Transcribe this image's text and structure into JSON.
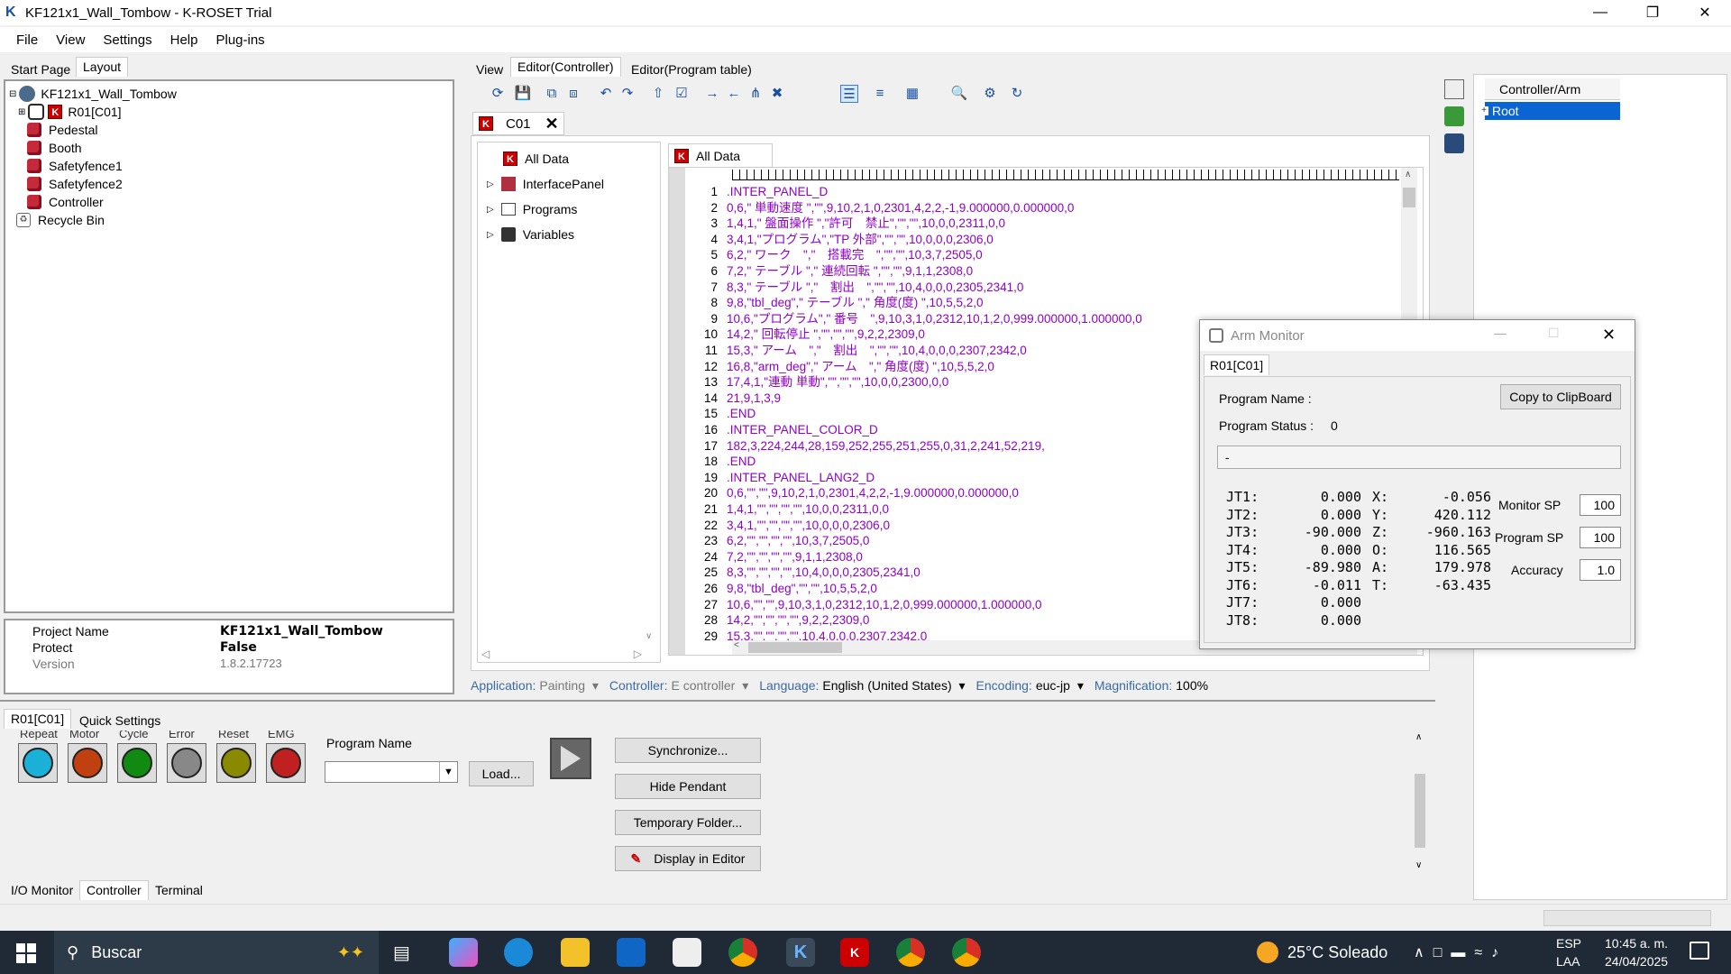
{
  "window": {
    "title": "KF121x1_Wall_Tombow - K-ROSET Trial"
  },
  "menu": [
    "File",
    "View",
    "Settings",
    "Help",
    "Plug-ins"
  ],
  "left_tabs": [
    "Start Page",
    "Layout"
  ],
  "tree": {
    "root": "KF121x1_Wall_Tombow",
    "robot": "R01[C01]",
    "items": [
      "Pedestal",
      "Booth",
      "Safetyfence1",
      "Safetyfence2",
      "Controller"
    ],
    "recycle": "Recycle Bin"
  },
  "properties": [
    {
      "name": "Project Name",
      "value": "KF121x1_Wall_Tombow"
    },
    {
      "name": "Protect",
      "value": "False"
    },
    {
      "name": "Version",
      "value": "1.8.2.17723"
    }
  ],
  "editor_tabs": [
    "View",
    "Editor(Controller)",
    "Editor(Program table)"
  ],
  "doc_tab": "C01",
  "nav_tree": {
    "root": "All Data",
    "items": [
      "InterfacePanel",
      "Programs",
      "Variables"
    ]
  },
  "code_tab": "All Data",
  "code_lines": [
    ".INTER_PANEL_D",
    "0,6,\" 単動速度 \",\"\",9,10,2,1,0,2301,4,2,2,-1,9.000000,0.000000,0",
    "1,4,1,\" 盤面操作 \",\"許可　禁止\",\"\",\"\",10,0,0,2311,0,0",
    "3,4,1,\"プログラム\",\"TP 外部\",\"\",\"\",10,0,0,0,2306,0",
    "6,2,\" ワーク　\",\"　搭載完　\",\"\",\"\",10,3,7,2505,0",
    "7,2,\" テーブル \",\" 連続回転 \",\"\",\"\",9,1,1,2308,0",
    "8,3,\" テーブル \",\"　割出　\",\"\",\"\",10,4,0,0,0,2305,2341,0",
    "9,8,\"tbl_deg\",\" テーブル \",\" 角度(度) \",10,5,5,2,0",
    "10,6,\"プログラム\",\" 番号　\",9,10,3,1,0,2312,10,1,2,0,999.000000,1.000000,0",
    "14,2,\" 回転停止 \",\"\",\"\",\"\",9,2,2,2309,0",
    "15,3,\" アーム　\",\"　割出　\",\"\",\"\",10,4,0,0,0,2307,2342,0",
    "16,8,\"arm_deg\",\" アーム　\",\" 角度(度) \",10,5,5,2,0",
    "17,4,1,\"連動 単動\",\"\",\"\",\"\",10,0,0,2300,0,0",
    "21,9,1,3,9",
    ".END",
    ".INTER_PANEL_COLOR_D",
    "182,3,224,244,28,159,252,255,251,255,0,31,2,241,52,219,",
    ".END",
    ".INTER_PANEL_LANG2_D",
    "0,6,\"\",\"\",9,10,2,1,0,2301,4,2,2,-1,9.000000,0.000000,0",
    "1,4,1,\"\",\"\",\"\",\"\",10,0,0,2311,0,0",
    "3,4,1,\"\",\"\",\"\",\"\",10,0,0,0,2306,0",
    "6,2,\"\",\"\",\"\",\"\",10,3,7,2505,0",
    "7,2,\"\",\"\",\"\",\"\",9,1,1,2308,0",
    "8,3,\"\",\"\",\"\",\"\",10,4,0,0,0,2305,2341,0",
    "9,8,\"tbl_deg\",\"\",\"\",10,5,5,2,0",
    "10,6,\"\",\"\",9,10,3,1,0,2312,10,1,2,0,999.000000,1.000000,0",
    "14,2,\"\",\"\",\"\",\"\",9,2,2,2309,0",
    "15,3,\"\",\"\",\"\",\"\",10,4,0,0,0,2307,2342,0"
  ],
  "statusbar": {
    "app_label": "Application:",
    "app_value": "Painting",
    "ctrl_label": "Controller:",
    "ctrl_value": "E controller",
    "lang_label": "Language:",
    "lang_value": "English (United States)",
    "enc_label": "Encoding:",
    "enc_value": "euc-jp",
    "mag_label": "Magnification:",
    "mag_value": "100%"
  },
  "arm_monitor": {
    "title": "Arm Monitor",
    "tab": "R01[C01]",
    "program_name_label": "Program Name :",
    "program_status_label": "Program Status :",
    "program_status_value": "0",
    "copy_button": "Copy to ClipBoard",
    "field_value": "-",
    "joints": [
      {
        "label": "JT1:",
        "value": "0.000"
      },
      {
        "label": "JT2:",
        "value": "0.000"
      },
      {
        "label": "JT3:",
        "value": "-90.000"
      },
      {
        "label": "JT4:",
        "value": "0.000"
      },
      {
        "label": "JT5:",
        "value": "-89.980"
      },
      {
        "label": "JT6:",
        "value": "-0.011"
      },
      {
        "label": "JT7:",
        "value": "0.000"
      },
      {
        "label": "JT8:",
        "value": "0.000"
      }
    ],
    "coords": [
      {
        "label": "X:",
        "value": "-0.056"
      },
      {
        "label": "Y:",
        "value": "420.112"
      },
      {
        "label": "Z:",
        "value": "-960.163"
      },
      {
        "label": "O:",
        "value": "116.565"
      },
      {
        "label": "A:",
        "value": "179.978"
      },
      {
        "label": "T:",
        "value": "-63.435"
      }
    ],
    "monitor_sp_label": "Monitor SP",
    "monitor_sp": "100",
    "program_sp_label": "Program SP",
    "program_sp": "100",
    "accuracy_label": "Accuracy",
    "accuracy": "1.0"
  },
  "right_panel": {
    "header": "Controller/Arm",
    "root": "Root"
  },
  "bottom_tabs": [
    "R01[C01]",
    "Quick Settings"
  ],
  "indicators": {
    "labels": [
      "Repeat",
      "Motor",
      "Cycle",
      "Error",
      "Reset",
      "EMG"
    ],
    "colors": [
      "#1ab0d8",
      "#c04010",
      "#108a10",
      "#888888",
      "#8a8a00",
      "#c02020"
    ]
  },
  "program_name_label": "Program Name",
  "load_button": "Load...",
  "right_buttons": [
    "Synchronize...",
    "Hide Pendant",
    "Temporary Folder...",
    "Display in Editor"
  ],
  "bottom_nav_tabs": [
    "I/O Monitor",
    "Controller",
    "Terminal"
  ],
  "taskbar": {
    "search": "Buscar",
    "weather": "25°C  Soleado",
    "lang1": "ESP",
    "lang2": "LAA",
    "time": "10:45 a. m.",
    "date": "24/04/2025"
  }
}
